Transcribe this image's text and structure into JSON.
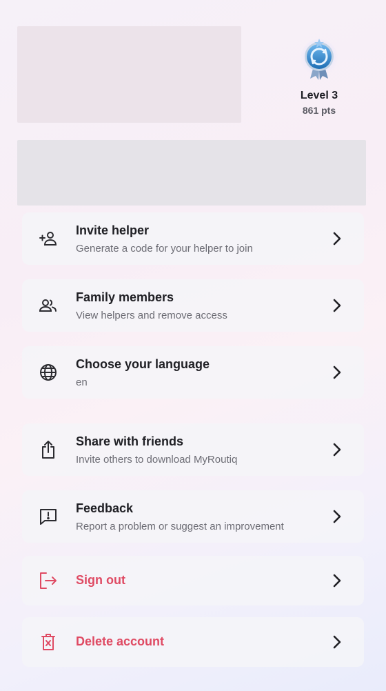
{
  "level": {
    "title": "Level 3",
    "points": "861 pts",
    "badge_icon": "level-medal-icon"
  },
  "menu": [
    {
      "id": "invite-helper",
      "title": "Invite helper",
      "subtitle": "Generate a code for your helper to join",
      "icon": "person-add-icon"
    },
    {
      "id": "family-members",
      "title": "Family members",
      "subtitle": "View helpers and remove access",
      "icon": "people-icon"
    },
    {
      "id": "choose-language",
      "title": "Choose your language",
      "subtitle": "en",
      "icon": "globe-icon"
    },
    {
      "id": "share-friends",
      "title": "Share with friends",
      "subtitle": "Invite others to download MyRoutiq",
      "icon": "share-icon"
    },
    {
      "id": "feedback",
      "title": "Feedback",
      "subtitle": "Report a problem or suggest an improvement",
      "icon": "feedback-icon"
    },
    {
      "id": "sign-out",
      "title": "Sign out",
      "icon": "sign-out-icon"
    },
    {
      "id": "delete-account",
      "title": "Delete account",
      "icon": "trash-icon"
    }
  ],
  "colors": {
    "danger": "#df4a63",
    "text": "#1f1f24",
    "subtext": "#6c6c74"
  }
}
